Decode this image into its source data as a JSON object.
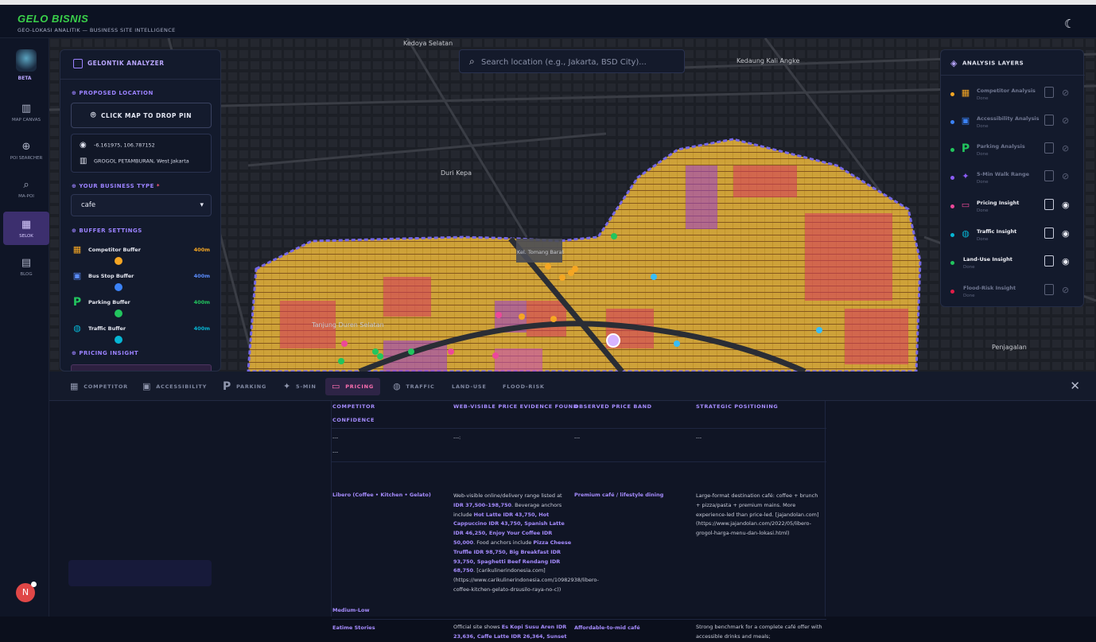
{
  "app": {
    "brand": "GELO BISNIS",
    "tagline": "GEO-LOKASI ANALITIK — BUSINESS SITE INTELLIGENCE"
  },
  "nav": {
    "beta": "BETA",
    "items": [
      {
        "label": "MAP CANVAS",
        "icon": "map-icon"
      },
      {
        "label": "POI SEARCHER",
        "icon": "poi-search-icon"
      },
      {
        "label": "MA-POI",
        "icon": "magnifier-icon"
      },
      {
        "label": "SELOK",
        "icon": "chart-icon",
        "active": true
      },
      {
        "label": "BLOG",
        "icon": "document-icon"
      }
    ],
    "avatar": "N"
  },
  "map": {
    "search_placeholder": "Search location (e.g., Jakarta, BSD City)...",
    "labels": [
      "Kedoya Selatan",
      "Kedaung Kali Angke",
      "Duri Kepa",
      "Tanjung Duren Selatan",
      "Penjagalan",
      "Kel. Tomang Barat"
    ]
  },
  "analyzer": {
    "title": "GELONTIK ANALYZER",
    "proposed_location": "PROPOSED LOCATION",
    "drop_pin": "CLICK MAP TO DROP PIN",
    "coords": "-6.161975, 106.787152",
    "area": "GROGOL PETAMBURAN, West Jakarta",
    "business_type_label": "YOUR BUSINESS TYPE",
    "required": "*",
    "business_type": "cafe",
    "buffer_settings": "BUFFER SETTINGS",
    "buffers": [
      {
        "name": "Competitor Buffer",
        "value": "400m",
        "color": "#f5a623",
        "icon": "storefront-icon"
      },
      {
        "name": "Bus Stop Buffer",
        "value": "400m",
        "color": "#3b82f6",
        "icon": "bus-icon"
      },
      {
        "name": "Parking Buffer",
        "value": "400m",
        "color": "#22c55e",
        "icon": "parking-icon"
      },
      {
        "name": "Traffic Buffer",
        "value": "400m",
        "color": "#06b6d4",
        "icon": "traffic-light-icon"
      }
    ],
    "pricing_insight": "PRICING INSIGHT"
  },
  "layers": {
    "title": "ANALYSIS LAYERS",
    "items": [
      {
        "name": "Competitor Analysis",
        "status": "Done",
        "color": "#f5a623",
        "visible": false
      },
      {
        "name": "Accessibility Analysis",
        "status": "Done",
        "color": "#3b82f6",
        "visible": false
      },
      {
        "name": "Parking Analysis",
        "status": "Done",
        "color": "#22c55e",
        "visible": false
      },
      {
        "name": "5-Min Walk Range",
        "status": "Done",
        "color": "#8b5cf6",
        "visible": false
      },
      {
        "name": "Pricing Insight",
        "status": "Done",
        "color": "#ec4899",
        "visible": true
      },
      {
        "name": "Traffic Insight",
        "status": "Done",
        "color": "#06b6d4",
        "visible": true
      },
      {
        "name": "Land-Use Insight",
        "status": "Done",
        "color": "#22c55e",
        "visible": true
      },
      {
        "name": "Flood-Risk Insight",
        "status": "Done",
        "color": "#e11d48",
        "visible": false
      }
    ]
  },
  "tabs": [
    "COMPETITOR",
    "ACCESSIBILITY",
    "PARKING",
    "5-MIN",
    "PRICING",
    "TRAFFIC",
    "LAND-USE",
    "FLOOD-RISK"
  ],
  "active_tab": "PRICING",
  "table": {
    "headers": [
      "COMPETITOR",
      "WEB-VISIBLE PRICE EVIDENCE FOUND",
      "OBSERVED PRICE BAND",
      "STRATEGIC POSITIONING",
      "CONFIDENCE"
    ],
    "placeholder_row": [
      "---",
      "---:",
      "---",
      "---",
      "---"
    ],
    "row1": {
      "competitor": "Libero (Coffee • Kitchen • Gelato)",
      "band": "Premium café / lifestyle dining",
      "positioning": "Large-format destination café: coffee + brunch + pizza/pasta + premium mains. More experience-led than price-led. [jajandolan.com] (https://www.jajandolan.com/2022/05/libero-grogol-harga-menu-dan-lokasi.html)",
      "confidence": "Medium-Low",
      "e1": "Web-visible online/delivery range listed at",
      "e2": "IDR 37,500–198,750",
      "e3": ". Beverage anchors include",
      "e4": "Hot Latte IDR 43,750, Hot Cappuccino IDR 43,750, Spanish Latte IDR 46,250, Enjoy Your Coffee IDR 50,000",
      "e5": ". Food anchors include",
      "e6": "Pizza Cheese Truffle IDR 98,750, Big Breakfast IDR 93,750, Spaghetti Beef Rendang IDR 68,750",
      "e7": ". [carikulinerindonesia.com] (https://www.carikulinerindonesia.com/10982938/libero-coffee-kitchen-gelato-drsusilo-raya-no-c))"
    },
    "row2": {
      "competitor": "Eatime Stories",
      "band": "Affordable-to-mid café",
      "positioning": "Strong benchmark for a complete café offer with accessible drinks and meals;",
      "e1": "Official site shows",
      "e2": "Es Kopi Susu Aren IDR 23,636, Caffe Latte IDR 26,364, Sunset"
    }
  }
}
